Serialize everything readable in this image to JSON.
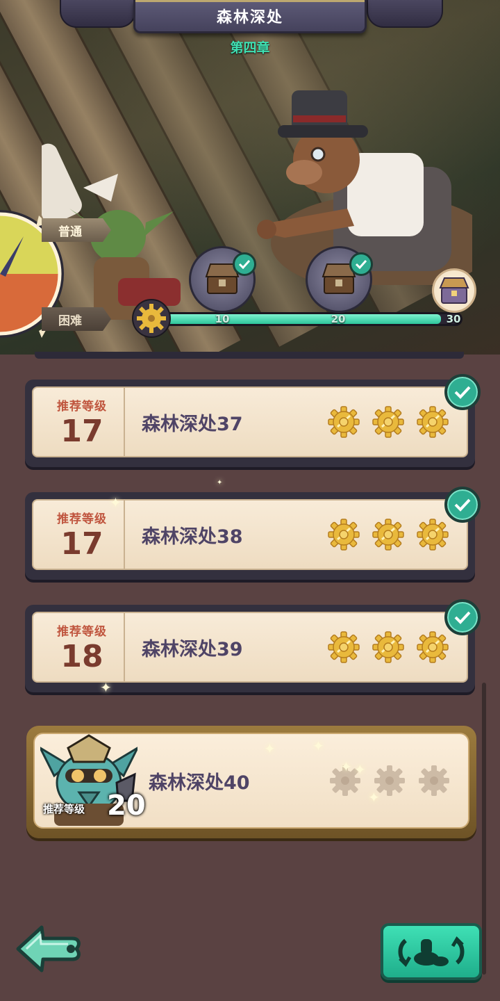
{
  "header": {
    "title": "森林深处",
    "chapter": "第四章"
  },
  "difficulty": {
    "normal": "普通",
    "hard": "困难",
    "selected": "普通"
  },
  "progress": {
    "current": 28,
    "max": 30,
    "milestones": [
      "10",
      "20",
      "30"
    ],
    "claimed": [
      true,
      true,
      false
    ]
  },
  "stages": [
    {
      "name": "森林深处37",
      "level_label": "推荐等级",
      "level": "17",
      "stars": 3,
      "cleared": true
    },
    {
      "name": "森林深处38",
      "level_label": "推荐等级",
      "level": "17",
      "stars": 3,
      "cleared": true
    },
    {
      "name": "森林深处39",
      "level_label": "推荐等级",
      "level": "18",
      "stars": 3,
      "cleared": true
    }
  ],
  "current_stage": {
    "name": "森林深处40",
    "level_label": "推荐等级",
    "level": "20",
    "stars": 0,
    "cleared": false
  },
  "colors": {
    "accent_teal": "#2fae92",
    "gear_gold": "#e9b93c",
    "card_bg": "#f8ebd8",
    "stage_text": "#4f4466",
    "level_text": "#7a3b2e"
  },
  "icons": {
    "back": "back-arrow-icon",
    "swap": "team-swap-icon",
    "star": "gear-star-icon",
    "check": "check-icon",
    "chest": "treasure-chest-icon"
  }
}
